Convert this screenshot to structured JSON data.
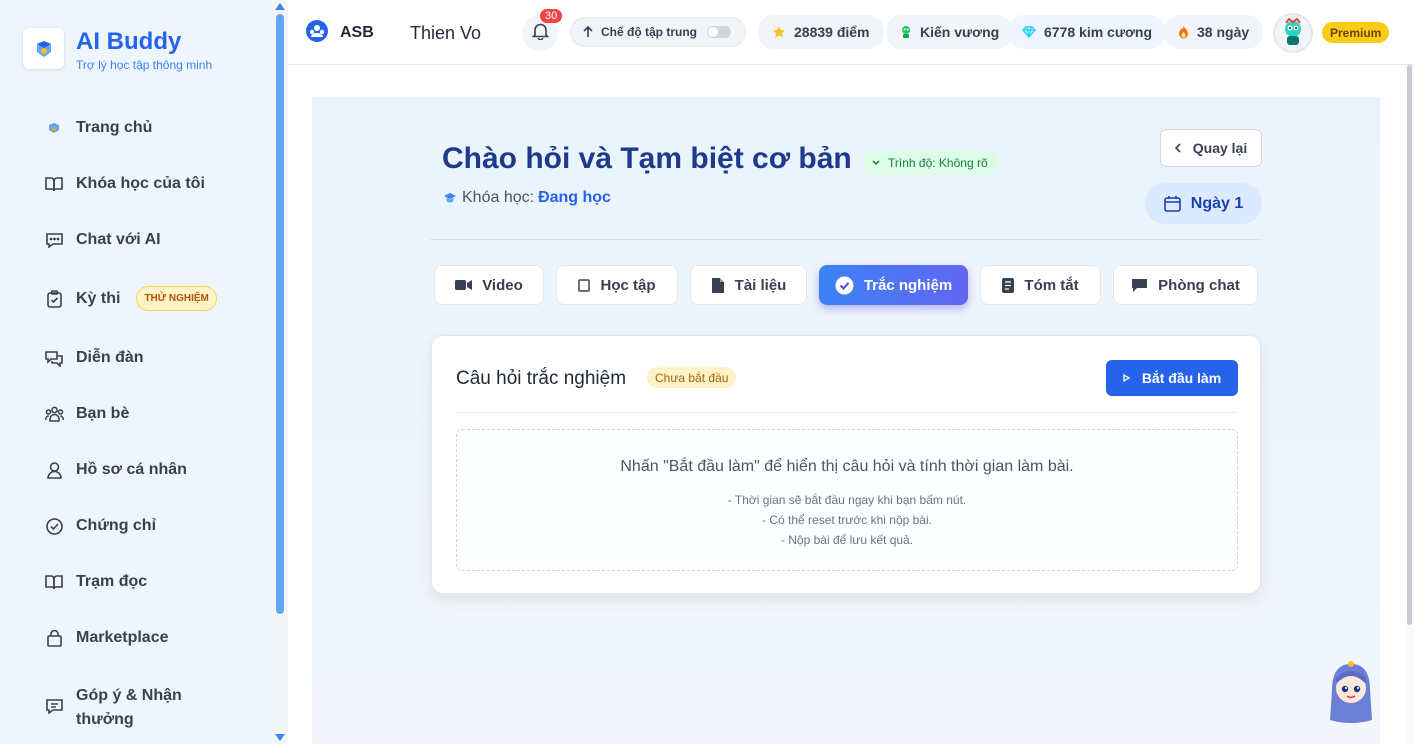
{
  "brand": {
    "name": "AI Buddy",
    "tagline": "Trợ lý học tập thông minh"
  },
  "sidebar": {
    "items": [
      {
        "label": "Trang chủ",
        "icon": "home-logo-icon"
      },
      {
        "label": "Khóa học của tôi",
        "icon": "book-open-icon"
      },
      {
        "label": "Chat với AI",
        "icon": "chat-icon"
      },
      {
        "label": "Kỳ thi",
        "icon": "clipboard-check-icon",
        "badge": "THỬ NGHIỆM"
      },
      {
        "label": "Diễn đàn",
        "icon": "forum-icon"
      },
      {
        "label": "Bạn bè",
        "icon": "users-icon"
      },
      {
        "label": "Hồ sơ cá nhân",
        "icon": "user-icon"
      },
      {
        "label": "Chứng chỉ",
        "icon": "check-circle-icon"
      },
      {
        "label": "Trạm đọc",
        "icon": "book-open-icon"
      },
      {
        "label": "Marketplace",
        "icon": "bag-icon"
      },
      {
        "label": "Góp ý & Nhận thưởng",
        "label_line1": "Góp ý & Nhận",
        "label_line2": "thưởng",
        "icon": "feedback-icon"
      }
    ]
  },
  "topbar": {
    "org": "ASB",
    "user": "Thien Vo",
    "notifications": "30",
    "focus_mode": "Chế độ tập trung",
    "points": "28839 điểm",
    "rank": "Kiến vương",
    "diamonds": "6778 kim cương",
    "streak": "38 ngày",
    "plan": "Premium"
  },
  "lesson": {
    "title": "Chào hỏi và Tạm biệt cơ bản",
    "level": "Trình độ: Không rõ",
    "course_label": "Khóa học:",
    "course_value": "Đang học",
    "back": "Quay lại",
    "day": "Ngày 1"
  },
  "tabs": [
    {
      "label": "Video",
      "icon": "video-icon"
    },
    {
      "label": "Học tập",
      "icon": "square-icon"
    },
    {
      "label": "Tài liệu",
      "icon": "document-icon"
    },
    {
      "label": "Trắc nghiệm",
      "icon": "check-circle-icon",
      "active": true
    },
    {
      "label": "Tóm tắt",
      "icon": "notes-icon"
    },
    {
      "label": "Phòng chat",
      "icon": "chat-bubble-icon"
    }
  ],
  "quiz": {
    "title": "Câu hỏi trắc nghiệm",
    "status": "Chưa bắt đầu",
    "start": "Bắt đầu làm",
    "instruction": "Nhấn \"Bắt đầu làm\" để hiển thị câu hỏi và tính thời gian làm bài.",
    "hints": [
      "- Thời gian sẽ bắt đầu ngay khi bạn bấm nút.",
      "- Có thể reset trước khi nộp bài.",
      "- Nộp bài để lưu kết quả."
    ]
  },
  "colors": {
    "accent": "#2563eb",
    "title": "#1e3a8a",
    "sidebar_bg": "#eef5fc"
  }
}
